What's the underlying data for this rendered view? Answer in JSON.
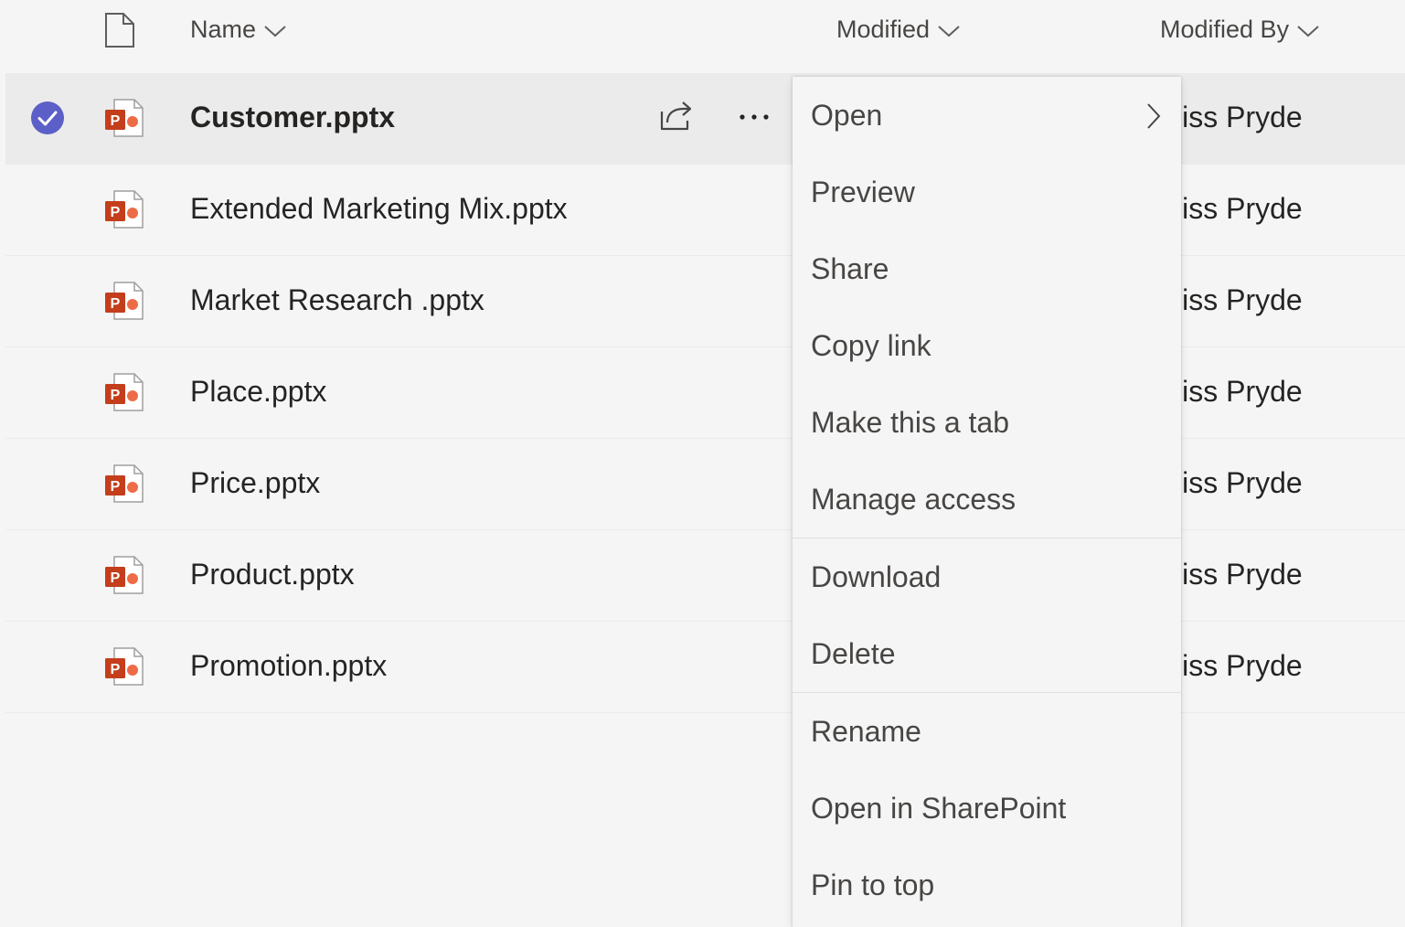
{
  "header": {
    "name_label": "Name",
    "modified_label": "Modified",
    "modified_by_label": "Modified By"
  },
  "files": [
    {
      "name": "Customer.pptx",
      "modified_by": "liss Pryde",
      "selected": true
    },
    {
      "name": "Extended Marketing Mix.pptx",
      "modified_by": "liss Pryde",
      "selected": false
    },
    {
      "name": "Market Research .pptx",
      "modified_by": "liss Pryde",
      "selected": false
    },
    {
      "name": "Place.pptx",
      "modified_by": "liss Pryde",
      "selected": false
    },
    {
      "name": "Price.pptx",
      "modified_by": "liss Pryde",
      "selected": false
    },
    {
      "name": "Product.pptx",
      "modified_by": "liss Pryde",
      "selected": false
    },
    {
      "name": "Promotion.pptx",
      "modified_by": "liss Pryde",
      "selected": false
    }
  ],
  "context_menu": {
    "items": [
      {
        "label": "Open",
        "has_submenu": true
      },
      {
        "label": "Preview"
      },
      {
        "label": "Share"
      },
      {
        "label": "Copy link"
      },
      {
        "label": "Make this a tab"
      },
      {
        "label": "Manage access"
      },
      {
        "label": "Download"
      },
      {
        "label": "Delete"
      },
      {
        "label": "Rename"
      },
      {
        "label": "Open in SharePoint"
      },
      {
        "label": "Pin to top"
      }
    ]
  },
  "colors": {
    "accent": "#5b5fc7",
    "powerpoint": "#c43e1c",
    "background": "#f5f5f5",
    "selected_row": "#ebebeb"
  },
  "icons": {
    "header_file": "document-icon",
    "file_type": "powerpoint-file-icon",
    "row_share": "share-icon",
    "row_more": "more-options-icon",
    "selected": "checkmark-circle-icon",
    "submenu": "chevron-right-icon"
  }
}
